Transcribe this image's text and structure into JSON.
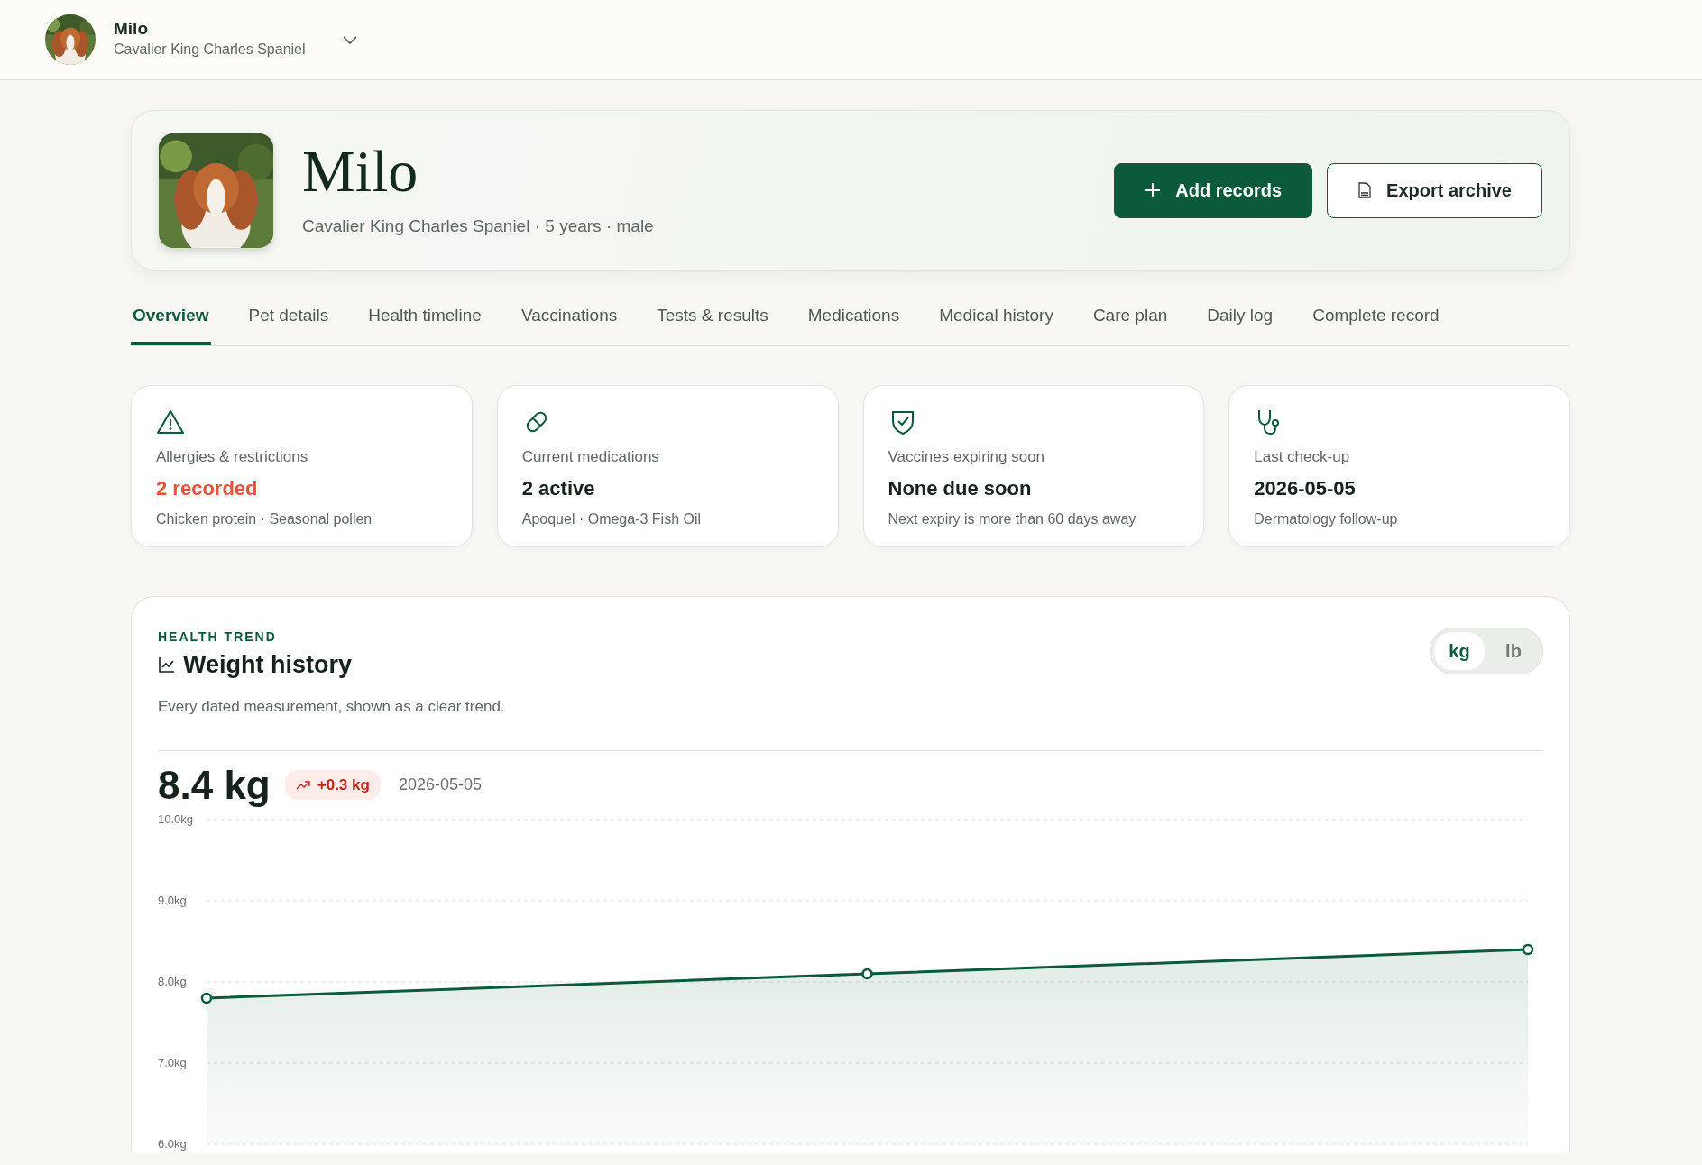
{
  "header": {
    "pet_name": "Milo",
    "pet_breed": "Cavalier King Charles Spaniel"
  },
  "hero": {
    "name": "Milo",
    "summary": "Cavalier King Charles Spaniel · 5 years · male",
    "buttons": [
      {
        "label": "Add records",
        "kind": "primary"
      },
      {
        "label": "Export archive",
        "kind": "outline"
      }
    ]
  },
  "tabs": [
    {
      "label": "Overview",
      "selected": true
    },
    {
      "label": "Pet details",
      "selected": false
    },
    {
      "label": "Health timeline",
      "selected": false
    },
    {
      "label": "Vaccinations",
      "selected": false
    },
    {
      "label": "Tests & results",
      "selected": false
    },
    {
      "label": "Medications",
      "selected": false
    },
    {
      "label": "Medical history",
      "selected": false
    },
    {
      "label": "Care plan",
      "selected": false
    },
    {
      "label": "Daily log",
      "selected": false
    },
    {
      "label": "Complete record",
      "selected": false
    }
  ],
  "summary_cards": [
    {
      "label": "Allergies & restrictions",
      "value": "2 recorded",
      "detail": "Chicken protein · Seasonal pollen",
      "alert": true
    },
    {
      "label": "Current medications",
      "value": "2 active",
      "detail": "Apoquel · Omega-3 Fish Oil",
      "alert": false
    },
    {
      "label": "Vaccines expiring soon",
      "value": "None due soon",
      "detail": "Next expiry is more than 60 days away",
      "alert": false
    },
    {
      "label": "Last check-up",
      "value": "2026-05-05",
      "detail": "Dermatology follow-up",
      "alert": false
    }
  ],
  "weight": {
    "eyebrow": "HEALTH TREND",
    "title": "Weight history",
    "description": "Every dated measurement, shown as a clear trend.",
    "units": [
      {
        "label": "kg",
        "selected": true
      },
      {
        "label": "lb",
        "selected": false
      }
    ],
    "current": "8.4 kg",
    "change": "+0.3 kg",
    "date": "2026-05-05",
    "chart_data": {
      "type": "area",
      "grid": true,
      "ylim": [
        6,
        10
      ],
      "yticks": [
        {
          "value": 10,
          "label": "10.0kg"
        },
        {
          "value": 9,
          "label": "9.0kg"
        },
        {
          "value": 8,
          "label": "8.0kg"
        },
        {
          "value": 7,
          "label": "7.0kg"
        },
        {
          "value": 6,
          "label": "6.0kg"
        }
      ],
      "series": [
        {
          "color": "#0b5a3b",
          "values": [
            7.8,
            8.1,
            8.4
          ]
        }
      ]
    }
  }
}
